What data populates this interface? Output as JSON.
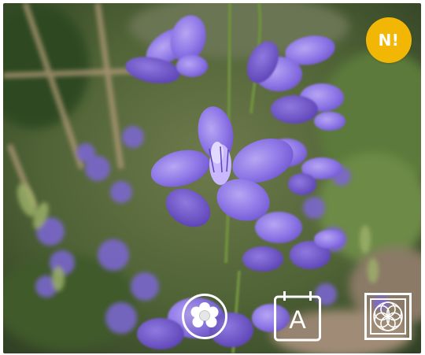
{
  "badge": {
    "label": "N!",
    "color": "#f2b705"
  },
  "toolbar": {
    "items": [
      {
        "icon": "flower-icon"
      },
      {
        "icon": "calendar-icon",
        "letter": "A"
      },
      {
        "icon": "flower-of-life-icon"
      }
    ]
  }
}
